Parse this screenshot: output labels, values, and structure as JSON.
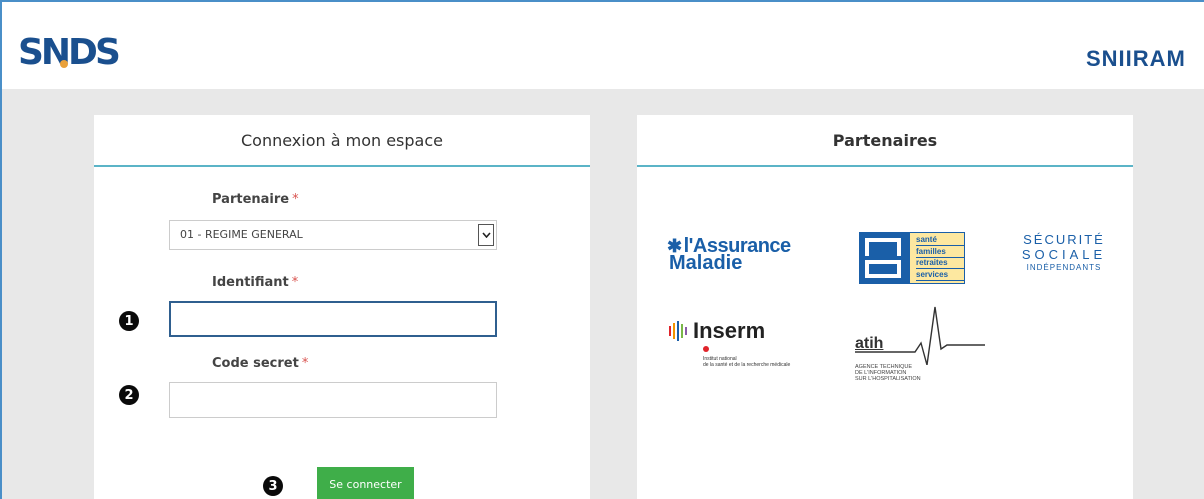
{
  "header": {
    "logo_text": "SNDS",
    "right_title": "SNIIRAM"
  },
  "login": {
    "title": "Connexion à mon espace",
    "partenaire_label": "Partenaire",
    "required_mark": "*",
    "partenaire_value": "01 - REGIME GENERAL",
    "identifiant_label": "Identifiant",
    "identifiant_value": "",
    "code_label": "Code secret",
    "code_value": "",
    "submit_label": "Se connecter",
    "badges": [
      "1",
      "2",
      "3"
    ]
  },
  "partners": {
    "title": "Partenaires",
    "assurance_maladie": {
      "line1": "l'Assurance",
      "line2": "Maladie"
    },
    "msa": {
      "lines": [
        "santé",
        "familles",
        "retraites",
        "services"
      ]
    },
    "securite_sociale": {
      "l1": "SÉCURITÉ",
      "l2": "SOCIALE",
      "l3": "INDÉPENDANTS"
    },
    "inserm": {
      "name": "Inserm",
      "sub1": "Institut national",
      "sub2": "de la santé et de la recherche médicale"
    },
    "atih": {
      "name": "atih",
      "sub1": "AGENCE TECHNIQUE",
      "sub2": "DE L'INFORMATION",
      "sub3": "SUR L'HOSPITALISATION"
    }
  },
  "colors": {
    "brand_blue": "#1a4f8e",
    "accent_teal": "#5bb4c7",
    "button_green": "#3fae49",
    "required_red": "#d9534f"
  }
}
